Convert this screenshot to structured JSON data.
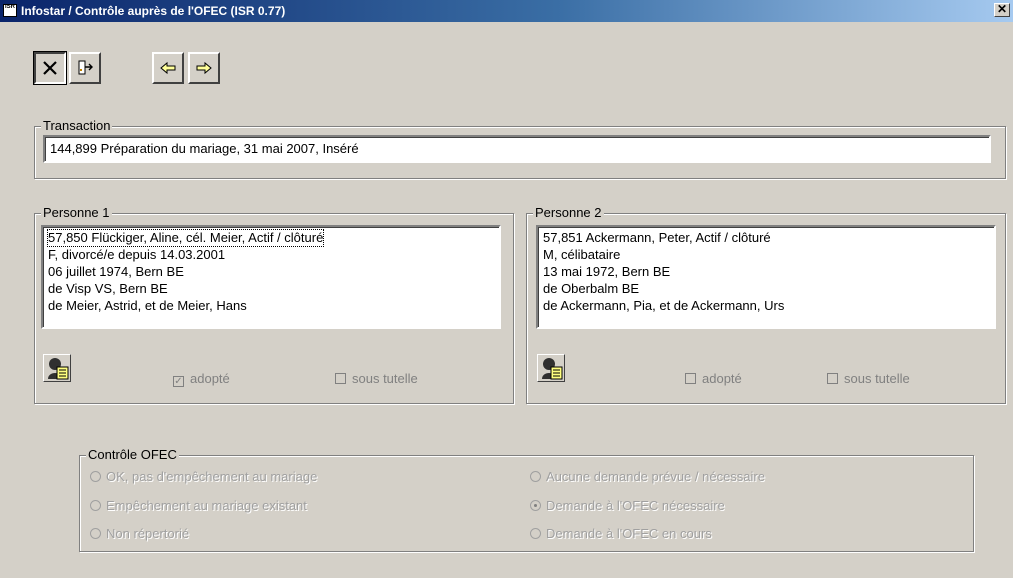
{
  "window": {
    "title": "Infostar / Contrôle auprès de l'OFEC (ISR 0.77)",
    "close_glyph": "✕",
    "app_icon_label": "ISR"
  },
  "toolbar": {
    "buttons": [
      {
        "name": "cancel",
        "icon": "x-icon",
        "pressed": true
      },
      {
        "name": "exit",
        "icon": "door-exit-icon",
        "pressed": false
      },
      {
        "name": "previous",
        "icon": "arrow-left-icon",
        "pressed": false
      },
      {
        "name": "next",
        "icon": "arrow-right-icon",
        "pressed": false
      }
    ]
  },
  "transaction": {
    "legend": "Transaction",
    "value": "144,899  Préparation du mariage, 31 mai 2007, Inséré"
  },
  "person1": {
    "legend": "Personne 1",
    "lines": [
      "57,850  Flückiger, Aline, cél. Meier, Actif / clôturé",
      "F, divorcé/e depuis 14.03.2001",
      "06 juillet 1974, Bern BE",
      "de Visp VS, Bern BE",
      "de Meier, Astrid, et de Meier, Hans"
    ],
    "adopted_label": "adopté",
    "adopted_checked": true,
    "guardianship_label": "sous tutelle",
    "guardianship_checked": false
  },
  "person2": {
    "legend": "Personne 2",
    "lines": [
      "57,851  Ackermann, Peter, Actif / clôturé",
      "M, célibataire",
      "13 mai 1972, Bern BE",
      "de Oberbalm BE",
      "de Ackermann, Pia, et de Ackermann, Urs"
    ],
    "adopted_label": "adopté",
    "adopted_checked": false,
    "guardianship_label": "sous tutelle",
    "guardianship_checked": false
  },
  "ofec": {
    "legend": "Contrôle OFEC",
    "left_options": [
      {
        "label": "OK, pas d'empêchement au mariage",
        "selected": false
      },
      {
        "label": "Empêchement au mariage existant",
        "selected": false
      },
      {
        "label": "Non répertorié",
        "selected": false
      }
    ],
    "right_options": [
      {
        "label": "Aucune demande prévue / nécessaire",
        "selected": false
      },
      {
        "label": "Demande à l'OFEC nécessaire",
        "selected": true
      },
      {
        "label": "Demande à l'OFEC en cours",
        "selected": false
      }
    ]
  },
  "colors": {
    "window_bg": "#d4d0c8",
    "titlebar_start": "#0a246a",
    "titlebar_end": "#a6caf0",
    "disabled_text": "#808080"
  }
}
